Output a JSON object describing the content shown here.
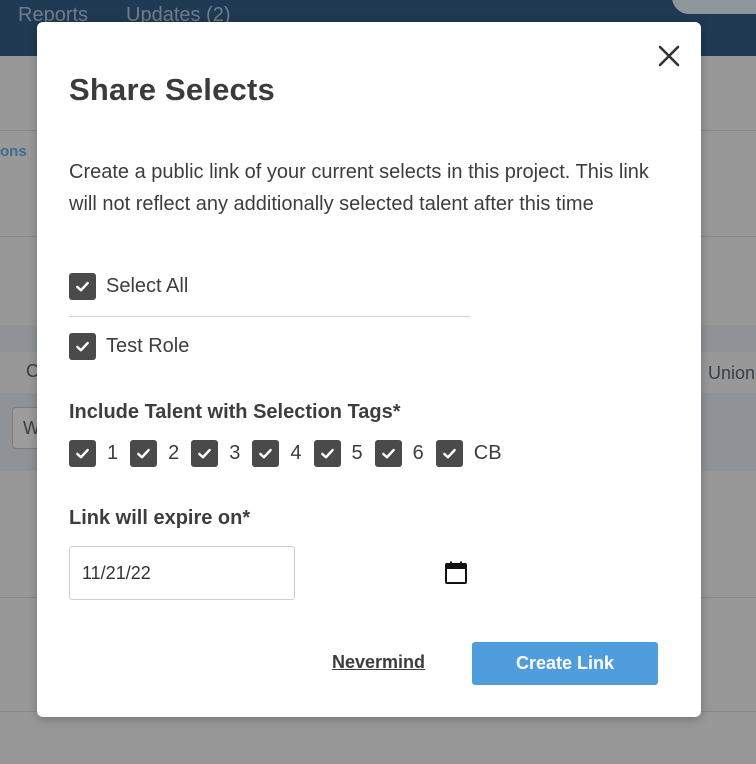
{
  "background": {
    "nav_items": [
      "Reports",
      "Updates (2)"
    ],
    "link_fragment": "ons",
    "col_fragment_left": "C",
    "col_fragment_right": "Union",
    "input_fragment": "W"
  },
  "modal": {
    "title": "Share Selects",
    "description": "Create a public link of your current selects in this project. This link will not reflect any additionally selected talent after this time",
    "select_all_label": "Select All",
    "roles": [
      {
        "label": "Test Role",
        "checked": true
      }
    ],
    "tags_label": "Include Talent with Selection Tags*",
    "tags": [
      {
        "label": "1",
        "checked": true
      },
      {
        "label": "2",
        "checked": true
      },
      {
        "label": "3",
        "checked": true
      },
      {
        "label": "4",
        "checked": true
      },
      {
        "label": "5",
        "checked": true
      },
      {
        "label": "6",
        "checked": true
      },
      {
        "label": "CB",
        "checked": true
      }
    ],
    "expire_label": "Link will expire on*",
    "expire_value": "11/21/22",
    "cancel_label": "Nevermind",
    "submit_label": "Create Link",
    "icons": {
      "close": "close-icon",
      "calendar": "calendar-icon",
      "check": "check-icon"
    }
  },
  "colors": {
    "primary_button": "#4f9ddd",
    "checkbox_fill": "#4a4a4a",
    "nav_background": "#1f3a52"
  }
}
